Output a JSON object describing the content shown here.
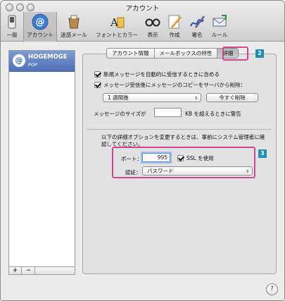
{
  "window": {
    "title": "アカウント"
  },
  "toolbar": {
    "items": [
      {
        "label": "一般",
        "icon": "switch-icon"
      },
      {
        "label": "アカウント",
        "icon": "at-sign-icon"
      },
      {
        "label": "迷惑メール",
        "icon": "junk-mail-icon"
      },
      {
        "label": "フォントとカラー",
        "icon": "fonts-colors-icon"
      },
      {
        "label": "表示",
        "icon": "glasses-icon"
      },
      {
        "label": "作成",
        "icon": "pencil-icon"
      },
      {
        "label": "署名",
        "icon": "signature-icon"
      },
      {
        "label": "ルール",
        "icon": "rules-icon"
      }
    ]
  },
  "sidebar": {
    "account": {
      "name": "HOGEMOGE",
      "type": "POP",
      "icon_glyph": "@"
    },
    "add_label": "+",
    "remove_label": "−"
  },
  "tabs": [
    {
      "label": "アカウント情報"
    },
    {
      "label": "メールボックスの特性"
    },
    {
      "label": "詳細"
    }
  ],
  "settings": {
    "auto_check_label": "新規メッセージを自動的に受信するときに含める",
    "auto_check_checked": true,
    "remove_copy_label": "メッセージ受信後にメッセージのコピーをサーバから削除：",
    "remove_copy_checked": true,
    "remove_period_value": "1 週間後",
    "remove_now_label": "今すぐ削除",
    "message_size_prefix": "メッセージのサイズが",
    "message_size_value": "",
    "message_size_suffix": "KB を超えるときに警告",
    "advanced_note": "以下の詳細オプションを変更するときは、事前にシステム管理者に確認してください。",
    "port_label": "ポート：",
    "port_value": "995",
    "ssl_label": "SSL を使用",
    "ssl_checked": true,
    "auth_label": "認証：",
    "auth_value": "パスワード"
  },
  "callouts": {
    "tab_marker": "2",
    "port_marker": "3"
  },
  "help_label": "?",
  "colors": {
    "highlight": "#d4468f",
    "callout": "#1f8fb3",
    "selection": "#4e6fb5"
  }
}
